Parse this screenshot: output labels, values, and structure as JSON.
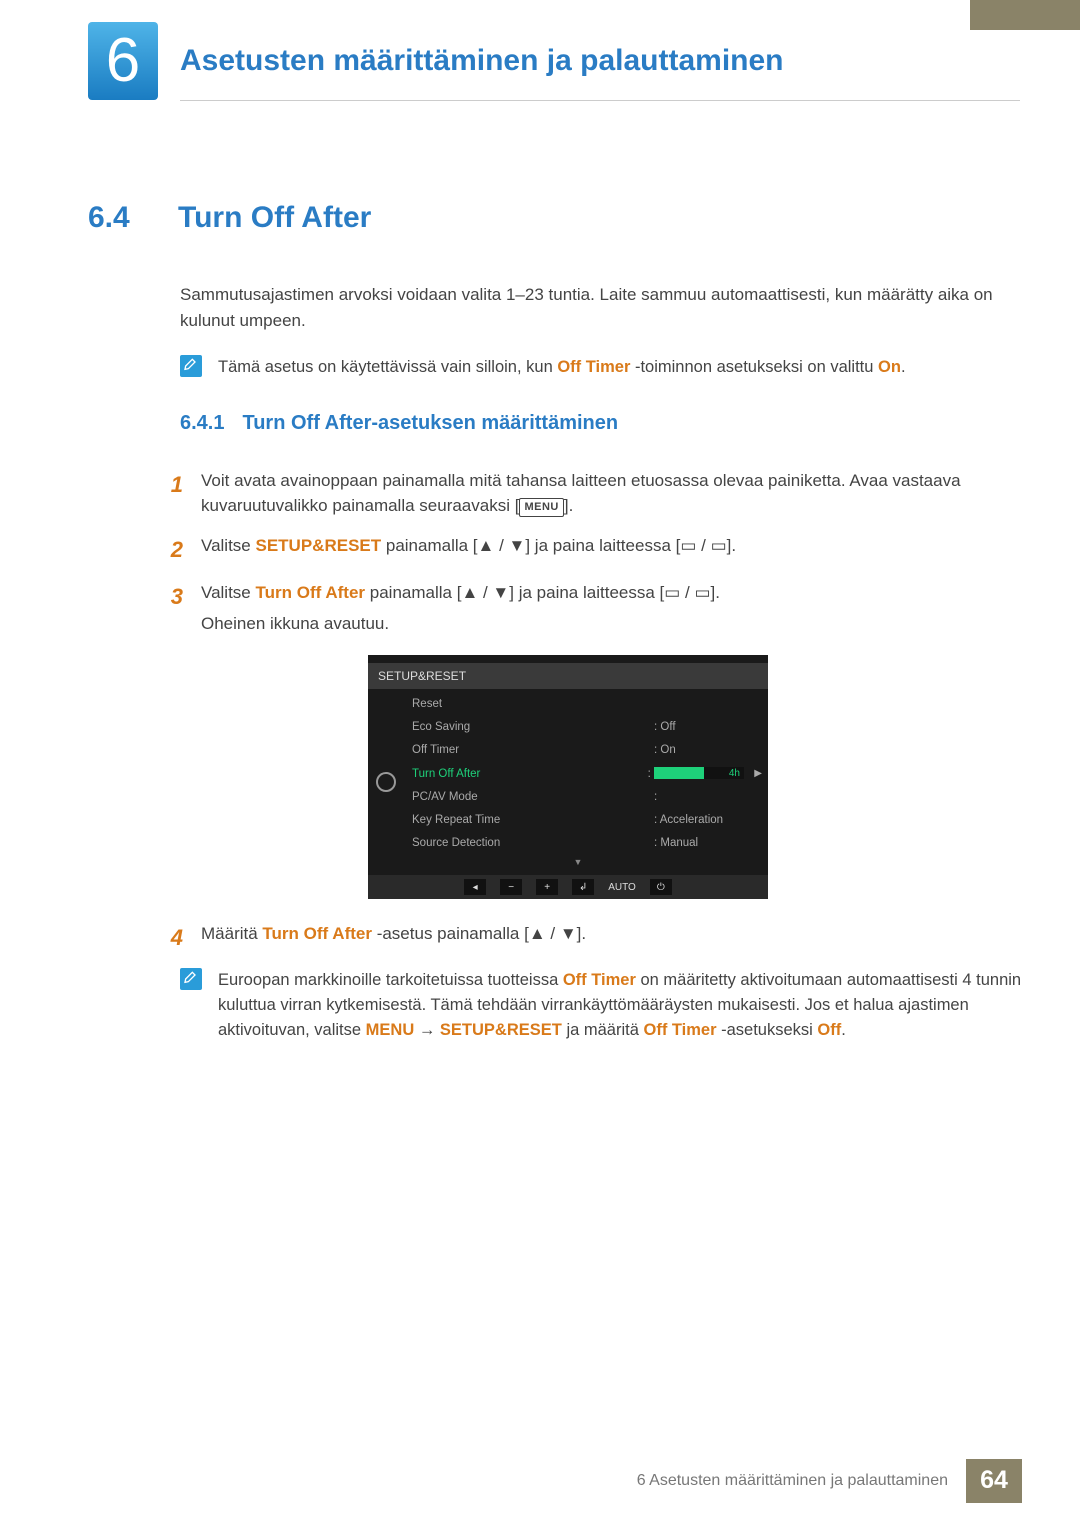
{
  "chapter": {
    "number": "6",
    "title": "Asetusten määrittäminen ja palauttaminen"
  },
  "section": {
    "number": "6.4",
    "title": "Turn Off After"
  },
  "intro": "Sammutusajastimen arvoksi voidaan valita 1–23 tuntia. Laite sammuu automaattisesti, kun määrätty aika on kulunut umpeen.",
  "note1": {
    "pre": "Tämä asetus on käytettävissä vain silloin, kun ",
    "kw1": "Off Timer",
    "mid": " -toiminnon asetukseksi on valittu ",
    "kw2": "On",
    "post": "."
  },
  "subsection": {
    "number": "6.4.1",
    "title": "Turn Off After-asetuksen määrittäminen"
  },
  "steps": {
    "s1": {
      "n": "1",
      "a": "Voit avata avainoppaan painamalla mitä tahansa laitteen etuosassa olevaa painiketta. Avaa vastaava kuvaruutuvalikko painamalla seuraavaksi [",
      "menu": "MENU",
      "b": "]."
    },
    "s2": {
      "n": "2",
      "a": "Valitse ",
      "kw": "SETUP&RESET",
      "b": " painamalla [",
      "sym1": "▲ / ▼",
      "c": "] ja paina laitteessa [",
      "sym2": "▭ / ▭",
      "d": "]."
    },
    "s3": {
      "n": "3",
      "a": "Valitse ",
      "kw": "Turn Off After",
      "b": " painamalla [",
      "sym1": "▲ / ▼",
      "c": "] ja paina laitteessa [",
      "sym2": "▭ / ▭",
      "d": "].",
      "tail": "Oheinen ikkuna avautuu."
    },
    "s4": {
      "n": "4",
      "a": "Määritä ",
      "kw": "Turn Off After",
      "b": " -asetus painamalla [",
      "sym1": "▲ / ▼",
      "c": "]."
    }
  },
  "osd": {
    "title": "SETUP&RESET",
    "rows": {
      "reset": {
        "l": "Reset",
        "v": ""
      },
      "eco": {
        "l": "Eco Saving",
        "v": ":   Off"
      },
      "timer": {
        "l": "Off Timer",
        "v": ":   On"
      },
      "toa": {
        "l": "Turn Off After",
        "v": "4h"
      },
      "pcav": {
        "l": "PC/AV Mode",
        "v": ":"
      },
      "krt": {
        "l": "Key Repeat Time",
        "v": ":   Acceleration"
      },
      "src": {
        "l": "Source Detection",
        "v": ":   Manual"
      }
    },
    "nav": {
      "auto": "AUTO"
    }
  },
  "note2": {
    "a": "Euroopan markkinoille tarkoitetuissa tuotteissa ",
    "kw1": "Off Timer",
    "b": " on määritetty aktivoitumaan automaattisesti 4 tunnin kuluttua virran kytkemisestä. Tämä tehdään virrankäyttömääräysten mukaisesti. Jos et halua ajastimen aktivoituvan, valitse ",
    "kw2": "MENU",
    "c": "  →  ",
    "kw3": "SETUP&RESET",
    "d": " ja määritä ",
    "kw4": "Off Timer",
    "e": " -asetukseksi ",
    "kw5": "Off",
    "f": "."
  },
  "footer": {
    "text": "6 Asetusten määrittäminen ja palauttaminen",
    "page": "64"
  }
}
